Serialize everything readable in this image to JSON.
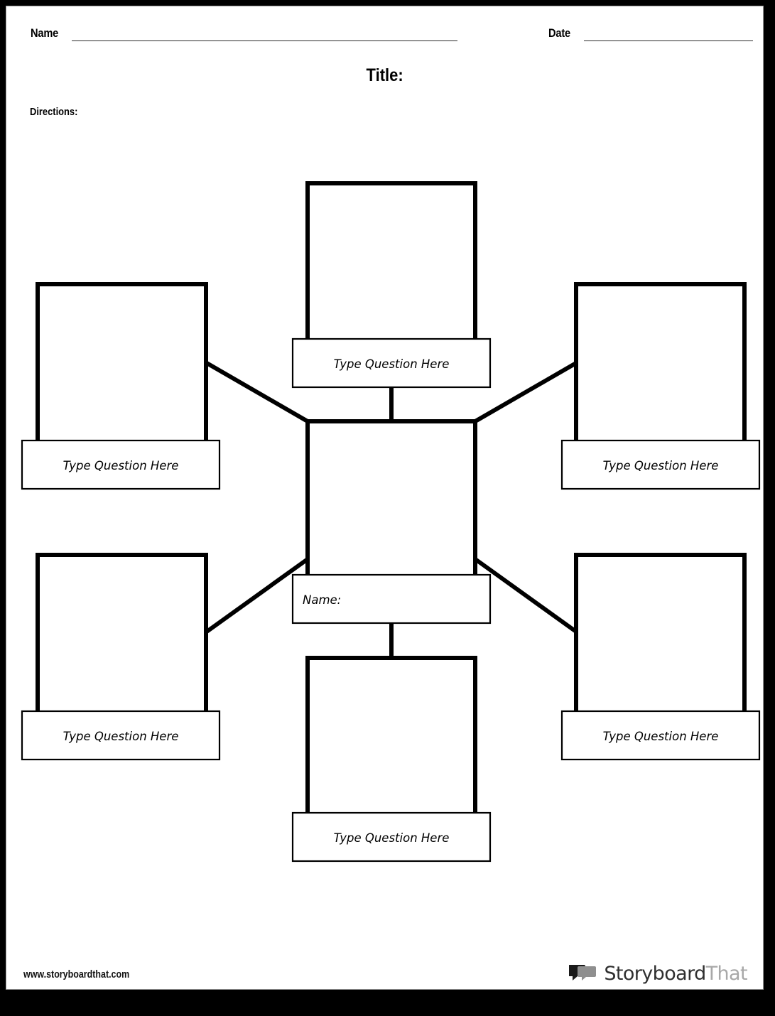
{
  "page": {
    "title": "Title:",
    "directions_label": "Directions:",
    "name_label": "Name",
    "date_label": "Date"
  },
  "footer": {
    "url": "www.storyboardthat.com",
    "brand_first": "Storyboard",
    "brand_second": "That",
    "logo_icon": "speech-bubbles-icon"
  },
  "diagram": {
    "type": "spider-map",
    "center": {
      "caption": "Name:",
      "caption_align": "left"
    },
    "spokes": [
      {
        "position": "top",
        "caption": "Type Question Here"
      },
      {
        "position": "top-left",
        "caption": "Type Question Here"
      },
      {
        "position": "top-right",
        "caption": "Type Question Here"
      },
      {
        "position": "bottom-left",
        "caption": "Type Question Here"
      },
      {
        "position": "bottom-right",
        "caption": "Type Question Here"
      },
      {
        "position": "bottom",
        "caption": "Type Question Here"
      }
    ]
  }
}
